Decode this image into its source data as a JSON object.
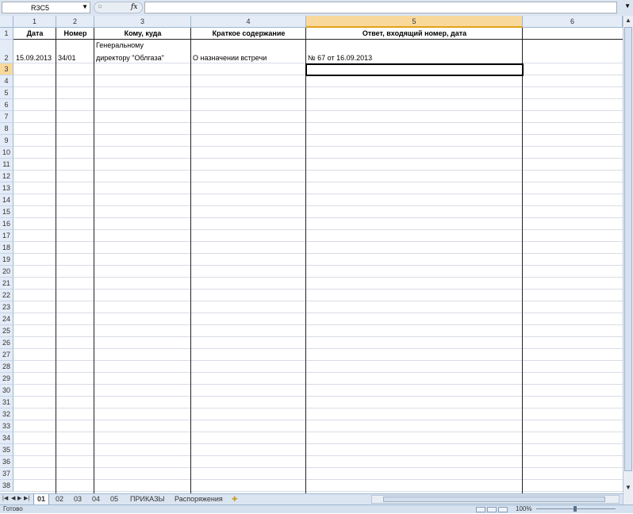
{
  "formula_bar": {
    "name_box": "R3C5",
    "fx_label": "fx",
    "formula": ""
  },
  "columns": [
    "1",
    "2",
    "3",
    "4",
    "5",
    "6"
  ],
  "selected_column": "5",
  "rows": [
    "1",
    "2",
    "3",
    "4",
    "5",
    "6",
    "7",
    "8",
    "9",
    "10",
    "11",
    "12",
    "13",
    "14",
    "15",
    "16",
    "17",
    "18",
    "19",
    "20",
    "21",
    "22",
    "23",
    "24",
    "25",
    "26",
    "27",
    "28",
    "29",
    "30",
    "31",
    "32",
    "33",
    "34",
    "35",
    "36",
    "37",
    "38"
  ],
  "selected_row": "3",
  "headers": {
    "c1": "Дата",
    "c2": "Номер",
    "c3": "Кому, куда",
    "c4": "Краткое содержание",
    "c5": "Ответ, входящий номер, дата"
  },
  "row2": {
    "c1": "15.09.2013",
    "c2": "34/01",
    "c3_line1": "Генеральному",
    "c3_line2": "директору \"Облгаза\"",
    "c4": "О назначении встречи",
    "c5": "№ 67 от 16.09.2013"
  },
  "sheet_tabs": {
    "tabs": [
      "01",
      "02",
      "03",
      "04",
      "05",
      "ПРИКАЗЫ",
      "Распоряжения"
    ],
    "active": "01"
  },
  "status_bar": {
    "text": "Готово",
    "zoom": "100%"
  }
}
